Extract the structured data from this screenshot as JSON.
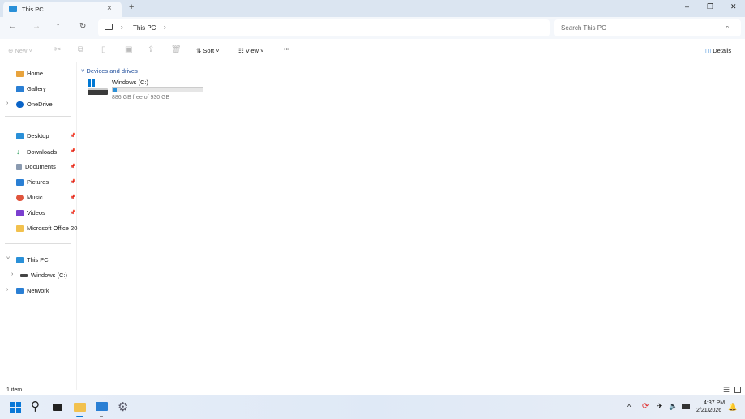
{
  "window": {
    "tab_title": "This PC",
    "new_tab": "+",
    "close_tab": "×",
    "minimize": "–",
    "restore": "❐",
    "close": "✕"
  },
  "address": {
    "breadcrumb": "This PC",
    "search_placeholder": "Search This PC"
  },
  "toolbar": {
    "new": "New",
    "sort": "Sort",
    "view": "View",
    "more": "•••",
    "details": "Details"
  },
  "sidebar": {
    "quick": [
      {
        "label": "Home",
        "icon": "home-icon",
        "color": "#e8a33d"
      },
      {
        "label": "Gallery",
        "icon": "gallery-icon",
        "color": "#2a7fd4"
      },
      {
        "label": "OneDrive",
        "icon": "cloud-icon",
        "color": "#0a64c8"
      }
    ],
    "pinned": [
      {
        "label": "Desktop",
        "color": "#2a90d8"
      },
      {
        "label": "Downloads",
        "color": "#2a9d5a"
      },
      {
        "label": "Documents",
        "color": "#8a9ab0"
      },
      {
        "label": "Pictures",
        "color": "#2a7fd4"
      },
      {
        "label": "Music",
        "color": "#e0543c"
      },
      {
        "label": "Videos",
        "color": "#7b3fd0"
      },
      {
        "label": "Microsoft Office 20",
        "color": "#f2c14e"
      }
    ],
    "tree": [
      {
        "label": "This PC"
      },
      {
        "label": "Windows (C:)"
      },
      {
        "label": "Network"
      }
    ]
  },
  "content": {
    "group": "Devices and drives",
    "drives": [
      {
        "name": "Windows (C:)",
        "free_text": "886 GB free of 930 GB",
        "used_fraction": 0.047
      }
    ]
  },
  "status": {
    "items": "1 item"
  },
  "taskbar": {
    "time": "4:37 PM",
    "date": "2/21/2026"
  }
}
